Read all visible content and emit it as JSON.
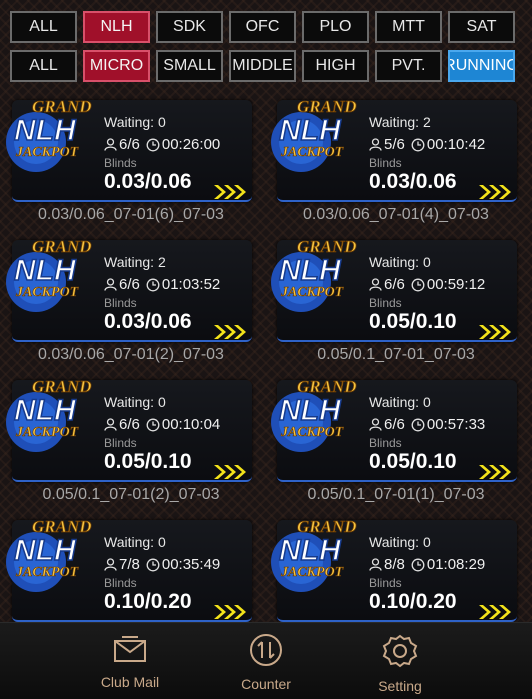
{
  "filters": {
    "row1": [
      {
        "label": "ALL",
        "state": "normal"
      },
      {
        "label": "NLH",
        "state": "active"
      },
      {
        "label": "SDK",
        "state": "normal"
      },
      {
        "label": "OFC",
        "state": "normal"
      },
      {
        "label": "PLO",
        "state": "normal"
      },
      {
        "label": "MTT",
        "state": "normal"
      },
      {
        "label": "SAT",
        "state": "normal"
      }
    ],
    "row2": [
      {
        "label": "ALL",
        "state": "normal"
      },
      {
        "label": "MICRO",
        "state": "active"
      },
      {
        "label": "SMALL",
        "state": "normal"
      },
      {
        "label": "MIDDLE",
        "state": "normal"
      },
      {
        "label": "HIGH",
        "state": "normal"
      },
      {
        "label": "PVT.",
        "state": "normal"
      },
      {
        "label": "RUNNING",
        "state": "running"
      }
    ]
  },
  "logo": {
    "line1": "GRAND",
    "line2": "NLH",
    "line3": "JACKPOT"
  },
  "tables": [
    {
      "waiting": "Waiting: 0",
      "players": "6/6",
      "timer": "00:26:00",
      "blinds_label": "Blinds",
      "blinds": "0.03/0.06",
      "name": "0.03/0.06_07-01(6)_07-03"
    },
    {
      "waiting": "Waiting: 2",
      "players": "5/6",
      "timer": "00:10:42",
      "blinds_label": "Blinds",
      "blinds": "0.03/0.06",
      "name": "0.03/0.06_07-01(4)_07-03"
    },
    {
      "waiting": "Waiting: 2",
      "players": "6/6",
      "timer": "01:03:52",
      "blinds_label": "Blinds",
      "blinds": "0.03/0.06",
      "name": "0.03/0.06_07-01(2)_07-03"
    },
    {
      "waiting": "Waiting: 0",
      "players": "6/6",
      "timer": "00:59:12",
      "blinds_label": "Blinds",
      "blinds": "0.05/0.10",
      "name": "0.05/0.1_07-01_07-03"
    },
    {
      "waiting": "Waiting: 0",
      "players": "6/6",
      "timer": "00:10:04",
      "blinds_label": "Blinds",
      "blinds": "0.05/0.10",
      "name": "0.05/0.1_07-01(2)_07-03"
    },
    {
      "waiting": "Waiting: 0",
      "players": "6/6",
      "timer": "00:57:33",
      "blinds_label": "Blinds",
      "blinds": "0.05/0.10",
      "name": "0.05/0.1_07-01(1)_07-03"
    },
    {
      "waiting": "Waiting: 0",
      "players": "7/8",
      "timer": "00:35:49",
      "blinds_label": "Blinds",
      "blinds": "0.10/0.20",
      "name": ""
    },
    {
      "waiting": "Waiting: 0",
      "players": "8/8",
      "timer": "01:08:29",
      "blinds_label": "Blinds",
      "blinds": "0.10/0.20",
      "name": ""
    }
  ],
  "bottom_nav": [
    {
      "label": "Club Mail",
      "icon": "mail-icon"
    },
    {
      "label": "Counter",
      "icon": "counter-icon"
    },
    {
      "label": "Setting",
      "icon": "gear-icon"
    }
  ],
  "colors": {
    "active": "#a0102a",
    "running": "#1e86d4",
    "accent_arrow": "#f2e21a",
    "nav_text": "#c9a98a"
  }
}
